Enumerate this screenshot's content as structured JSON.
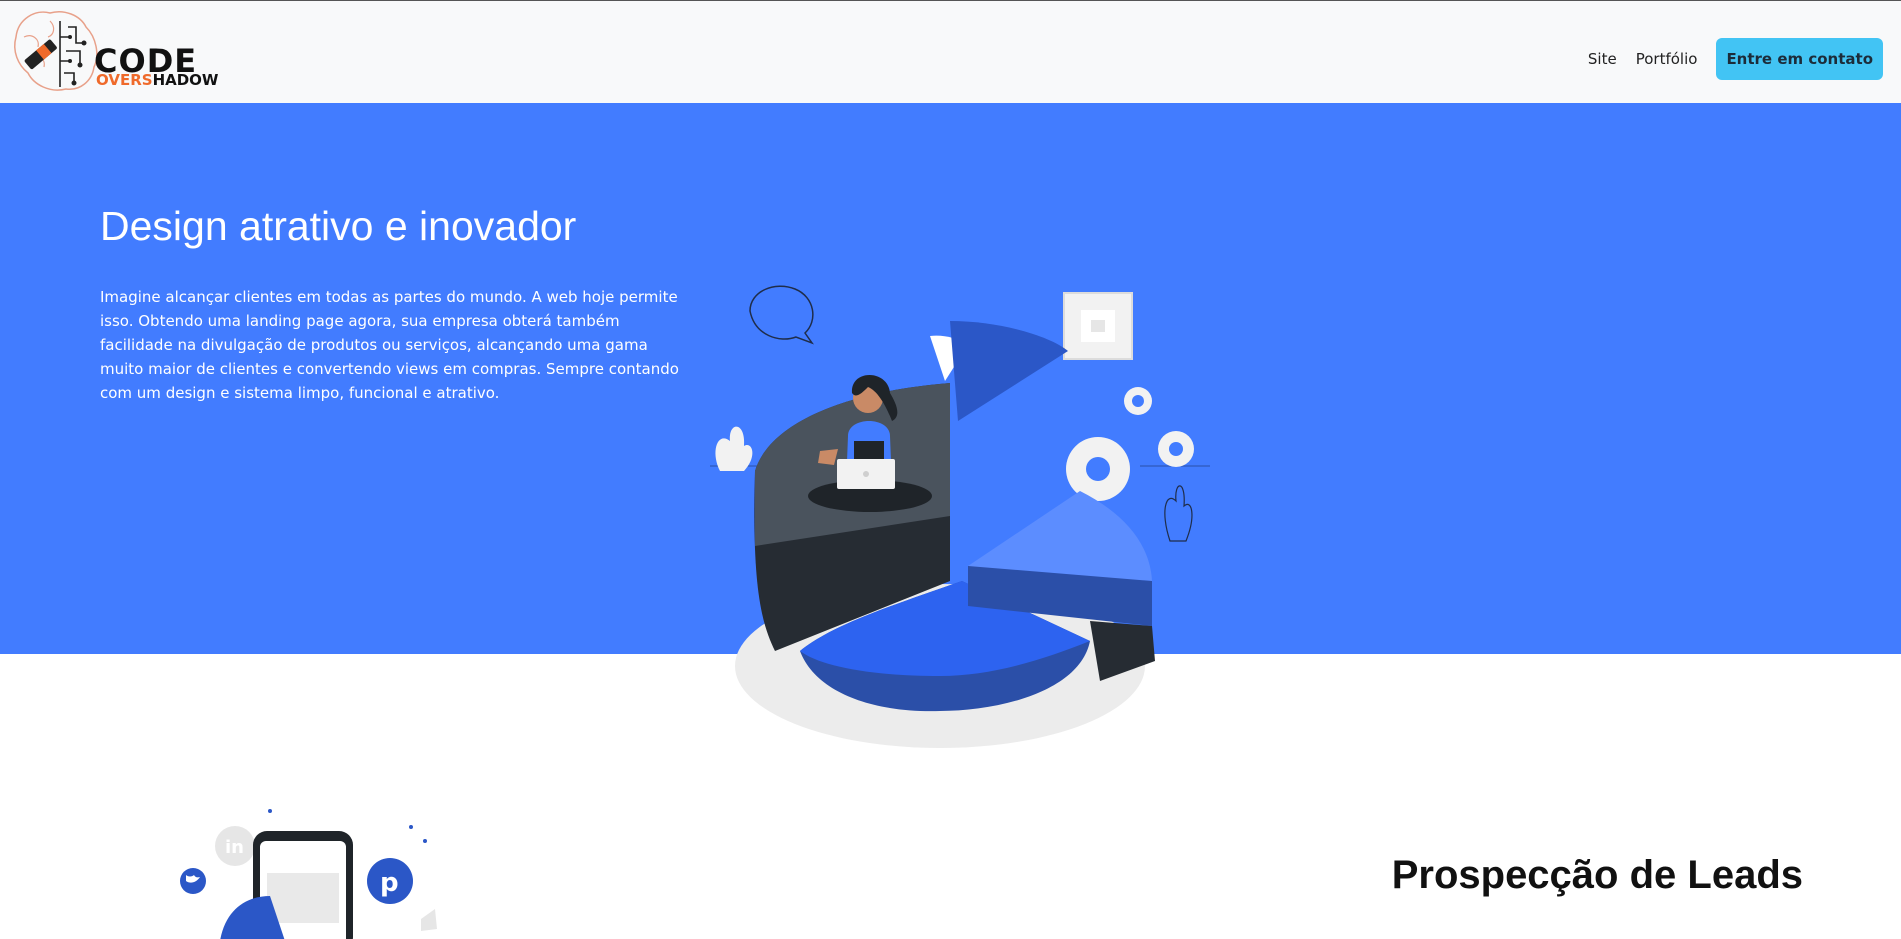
{
  "header": {
    "logo": {
      "main": "CODE",
      "sub_accent": "OVERS",
      "sub_rest": "HADOW"
    },
    "nav": {
      "site_label": "Site",
      "portfolio_label": "Portfólio",
      "cta_label": "Entre em contato"
    }
  },
  "hero": {
    "title": "Design atrativo e inovador",
    "description": "Imagine alcançar clientes em todas as partes do mundo. A web hoje permite isso. Obtendo uma landing page agora, sua empresa obterá também facilidade na divulgação de produtos ou serviços, alcançando uma gama muito maior de clientes e convertendo views em compras. Sempre contando com um design e sistema limpo, funcional e atrativo.",
    "illustration_icon": "pie-chart-woman-laptop-illustration"
  },
  "leads": {
    "title": "Prospecção de Leads",
    "illustration_icon": "social-media-phone-illustration"
  },
  "colors": {
    "hero_bg": "#427cff",
    "cta_bg": "#42c4f4",
    "header_bg": "#f8f9fa",
    "logo_accent": "#ef6a2b"
  }
}
